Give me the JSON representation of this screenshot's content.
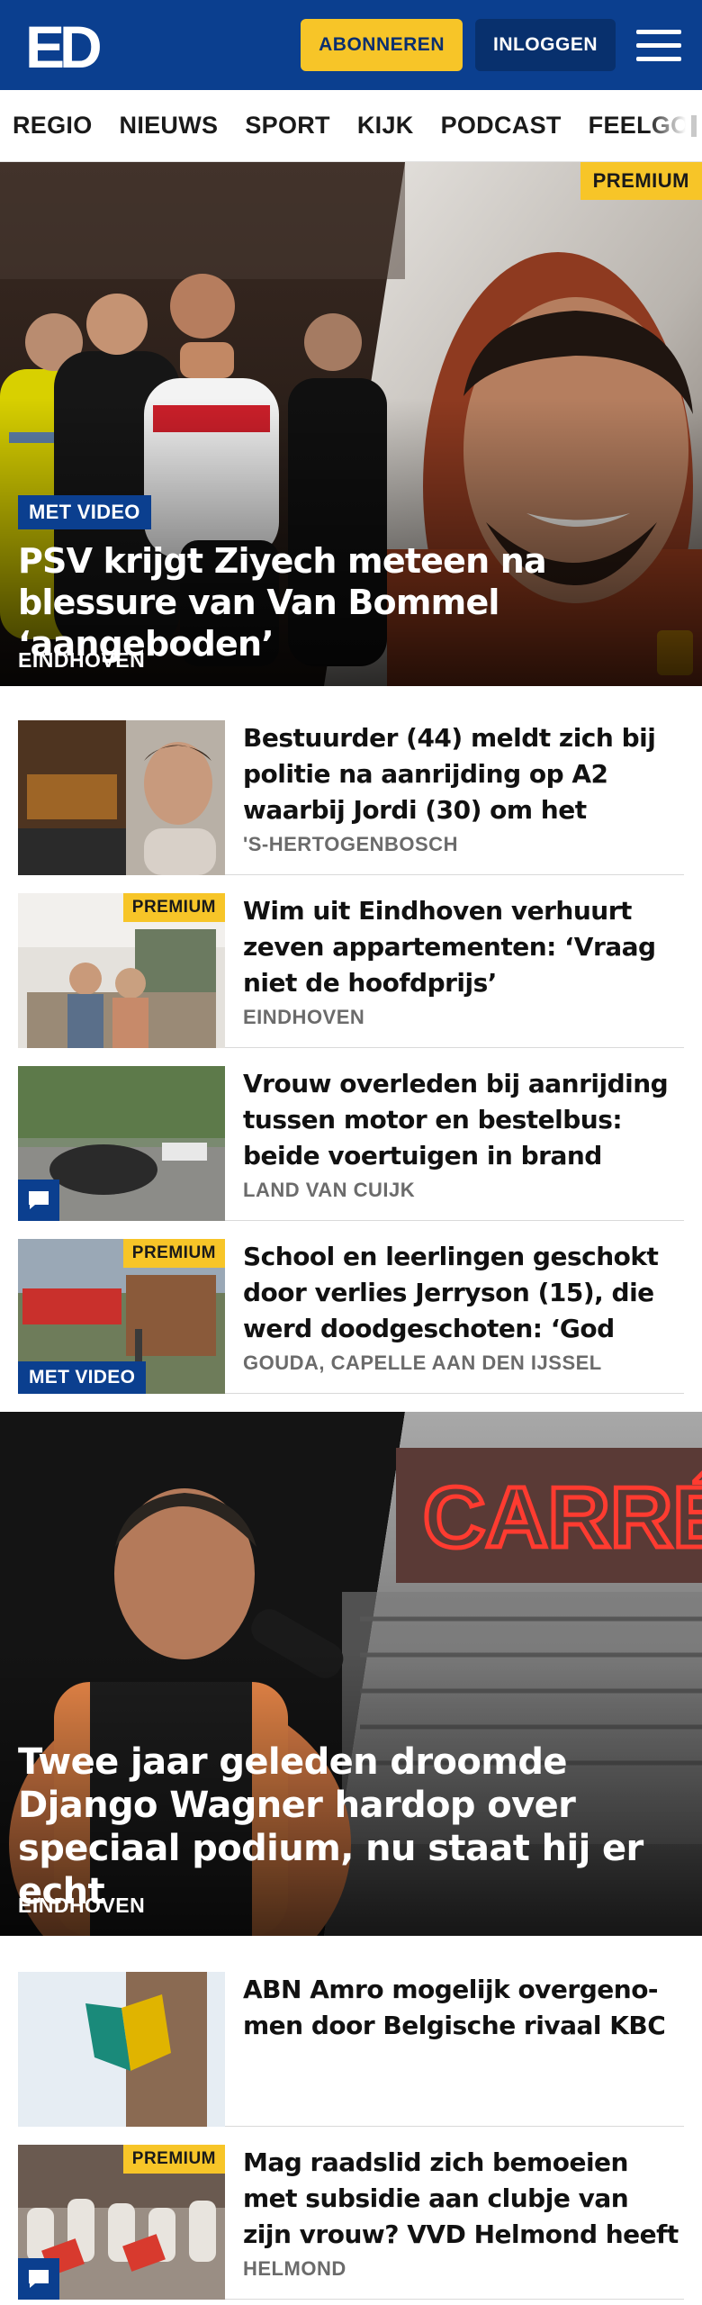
{
  "header": {
    "logo_text": "ED",
    "subscribe_label": "ABONNEREN",
    "login_label": "INLOGGEN"
  },
  "nav": {
    "items": [
      "REGIO",
      "NIEUWS",
      "SPORT",
      "KIJK",
      "PODCAST",
      "FEELGOOD"
    ]
  },
  "hero": {
    "premium_label": "PREMIUM",
    "video_label": "MET VIDEO",
    "title": "PSV krijgt Ziyech meteen na blessure van Van Bommel ‘aangeboden’",
    "location": "EINDHOVEN"
  },
  "articles": [
    {
      "title": "Bestuurder (44) meldt zich bij politie na aanrijding op A2 waarbij Jordi (30) om het leven...",
      "location": "'S-HERTOGENBOSCH"
    },
    {
      "premium_label": "PREMIUM",
      "title": "Wim uit Eindhoven verhuurt zeven appartementen: ‘Vraag niet de hoofdprijs’",
      "location": "EINDHOVEN"
    },
    {
      "title": "Vrouw overleden bij aanrijding tussen motor en bestelbus: beide voertuigen in brand gevlogen",
      "location": "LAND VAN CUIJK"
    },
    {
      "premium_label": "PREMIUM",
      "video_label": "MET VIDEO",
      "title": "School en leerlingen geschokt door verlies Jerryson (15), die werd doodgeschoten: ‘God had...",
      "location": "GOUDA, CAPELLE AAN DEN IJSSEL"
    }
  ],
  "hero2": {
    "sign_text": "CARRÉ",
    "title": "Twee jaar geleden droomde Django Wagner hardop over speciaal podium, nu staat hij er echt",
    "location": "EINDHOVEN"
  },
  "articles2": [
    {
      "title": "ABN Amro mogelijk overgeno-men door Belgische rivaal KBC",
      "location": ""
    },
    {
      "premium_label": "PREMIUM",
      "title": "Mag raadslid zich bemoeien met subsidie aan clubje van zijn vrouw? VVD Helmond heeft er...",
      "location": "HELMOND"
    }
  ],
  "colors": {
    "brand_blue": "#0b3f8f",
    "premium_yellow": "#f7c528",
    "login_dark_blue": "#08306d"
  },
  "icons": [
    "menu-icon",
    "comment-icon"
  ]
}
